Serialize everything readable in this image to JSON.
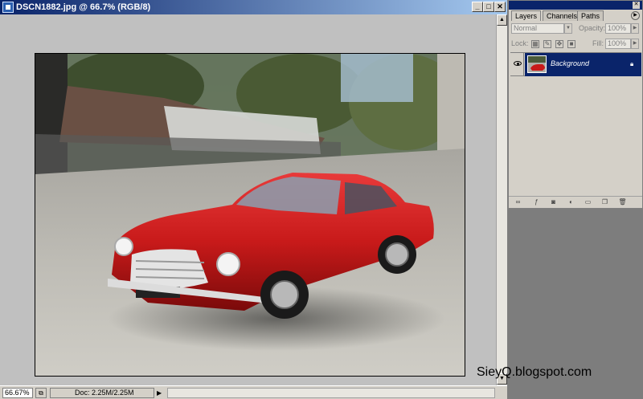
{
  "window": {
    "title": "DSCN1882.jpg @ 66.7% (RGB/8)",
    "controls": [
      "_",
      "□",
      "✕"
    ]
  },
  "status": {
    "zoom": "66.67%",
    "doc_size": "Doc: 2.25M/2.25M",
    "arrow": "▶"
  },
  "panel": {
    "tabs": [
      "Layers",
      "Channels",
      "Paths"
    ],
    "blend_mode": "Normal",
    "opacity_label": "Opacity:",
    "opacity_value": "100%",
    "lock_label": "Lock:",
    "fill_label": "Fill:",
    "fill_value": "100%",
    "layer_name": "Background"
  },
  "watermark": "SieyQ.blogspot.com",
  "colors": {
    "titlebar": "#0a246a",
    "selection": "#0a246a",
    "car_red": "#c81a1a"
  }
}
